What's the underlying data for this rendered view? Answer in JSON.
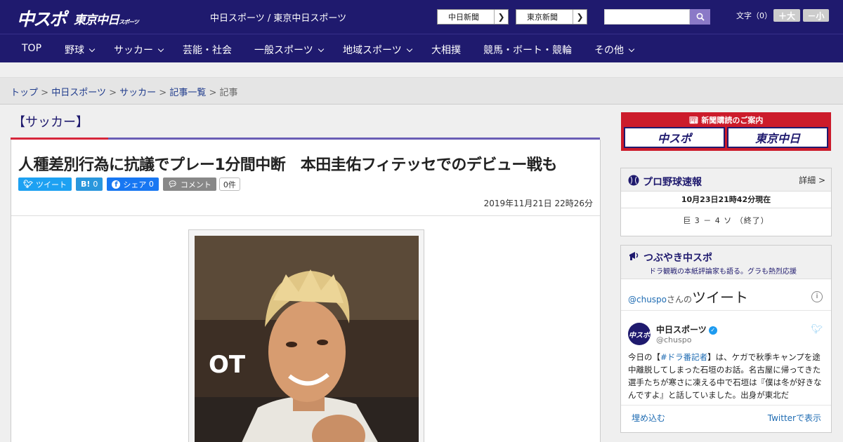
{
  "header": {
    "logo_main": "中スポ",
    "logo_sub": "東京中日",
    "logo_sub_small": "スポーツ",
    "site_name": "中日スポーツ / 東京中日スポーツ",
    "paper_links": [
      "中日新聞",
      "東京新聞"
    ],
    "font_size_label": "文字（0）",
    "font_larger": "＋大",
    "font_smaller": "－小"
  },
  "nav": {
    "items": [
      {
        "label": "TOP",
        "dropdown": false
      },
      {
        "label": "野球",
        "dropdown": true
      },
      {
        "label": "サッカー",
        "dropdown": true
      },
      {
        "label": "芸能・社会",
        "dropdown": false
      },
      {
        "label": "一般スポーツ",
        "dropdown": true
      },
      {
        "label": "地域スポーツ",
        "dropdown": true
      },
      {
        "label": "大相撲",
        "dropdown": false
      },
      {
        "label": "競馬・ボート・競輪",
        "dropdown": false
      },
      {
        "label": "その他",
        "dropdown": true
      }
    ]
  },
  "breadcrumb": {
    "items": [
      "トップ",
      "中日スポーツ",
      "サッカー",
      "記事一覧"
    ],
    "current": "記事",
    "separator": ">"
  },
  "article": {
    "category": "【サッカー】",
    "headline": "人種差別行為に抗議でプレー1分間中断　本田圭佑フィテッセでのデビュー戦も",
    "share": {
      "tweet": "ツイート",
      "hatena_icon": "B!",
      "hatena_count": "0",
      "facebook_label": "シェア",
      "facebook_count": "0",
      "comment_label": "コメント",
      "comment_count": "0件"
    },
    "date": "2019年11月21日 22時26分",
    "photo_text": "OT"
  },
  "sidebar": {
    "subscription": {
      "title": "新聞購読のご案内",
      "btn1": "中スポ",
      "btn2": "東京中日"
    },
    "baseball": {
      "title": "プロ野球速報",
      "detail": "詳細 >",
      "time": "10月23日21時42分現在",
      "score": "巨 3 － 4 ソ （終了）"
    },
    "tsubuyaki": {
      "title": "つぶやき中スポ",
      "subtitle": "ドラ観戦の本紙評論家も語る。グラも熱烈応援",
      "handle_prefix": "@chuspo",
      "handle_suffix": "さんの",
      "tweet_word": "ツイート",
      "account_name": "中日スポーツ",
      "account_handle": "@chuspo",
      "avatar_text": "中スポ",
      "tweet_pre": "今日の【",
      "tweet_hashtag": "#ドラ番記者",
      "tweet_body": "】は、ケガで秋季キャンプを途中離脱してしまった石垣のお話。名古屋に帰ってきた選手たちが寒さに凍える中で石垣は『僕は冬が好きなんですよ』と話していました。出身が東北だ",
      "embed": "埋め込む",
      "view_on_twitter": "Twitterで表示"
    }
  },
  "colors": {
    "navy": "#1f1a6e",
    "red": "#d6263b",
    "purple": "#6a5db5",
    "twitter": "#1da1f2",
    "hatena": "#2a97dd",
    "facebook": "#1877f2",
    "comment": "#888888"
  }
}
